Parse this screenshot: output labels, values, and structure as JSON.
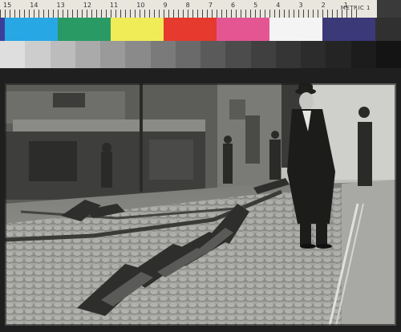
{
  "ruler": {
    "numbers": [
      "15",
      "14",
      "13",
      "12",
      "11",
      "10",
      "9",
      "8",
      "7",
      "6",
      "5",
      "4",
      "3",
      "2",
      "1"
    ],
    "label": "METRIC 1"
  },
  "color_patches": [
    "#3b3f9a",
    "#27a7e4",
    "#2a9a64",
    "#f0ec58",
    "#e53a2d",
    "#e35692",
    "#f4f4f4",
    "#3b3978",
    "#303030"
  ],
  "gray_patches": [
    "#dedede",
    "#cdcdcd",
    "#bcbcbc",
    "#aaaaaa",
    "#9a9a9a",
    "#8a8a8a",
    "#7a7a7a",
    "#6a6a6a",
    "#5a5a5a",
    "#4c4c4c",
    "#404040",
    "#353535",
    "#2c2c2c",
    "#242424",
    "#1c1c1c",
    "#141414"
  ],
  "photo": {
    "subject": "earthquake-damaged cobblestone street with buckled streetcar tracks and men in bowler hats"
  }
}
